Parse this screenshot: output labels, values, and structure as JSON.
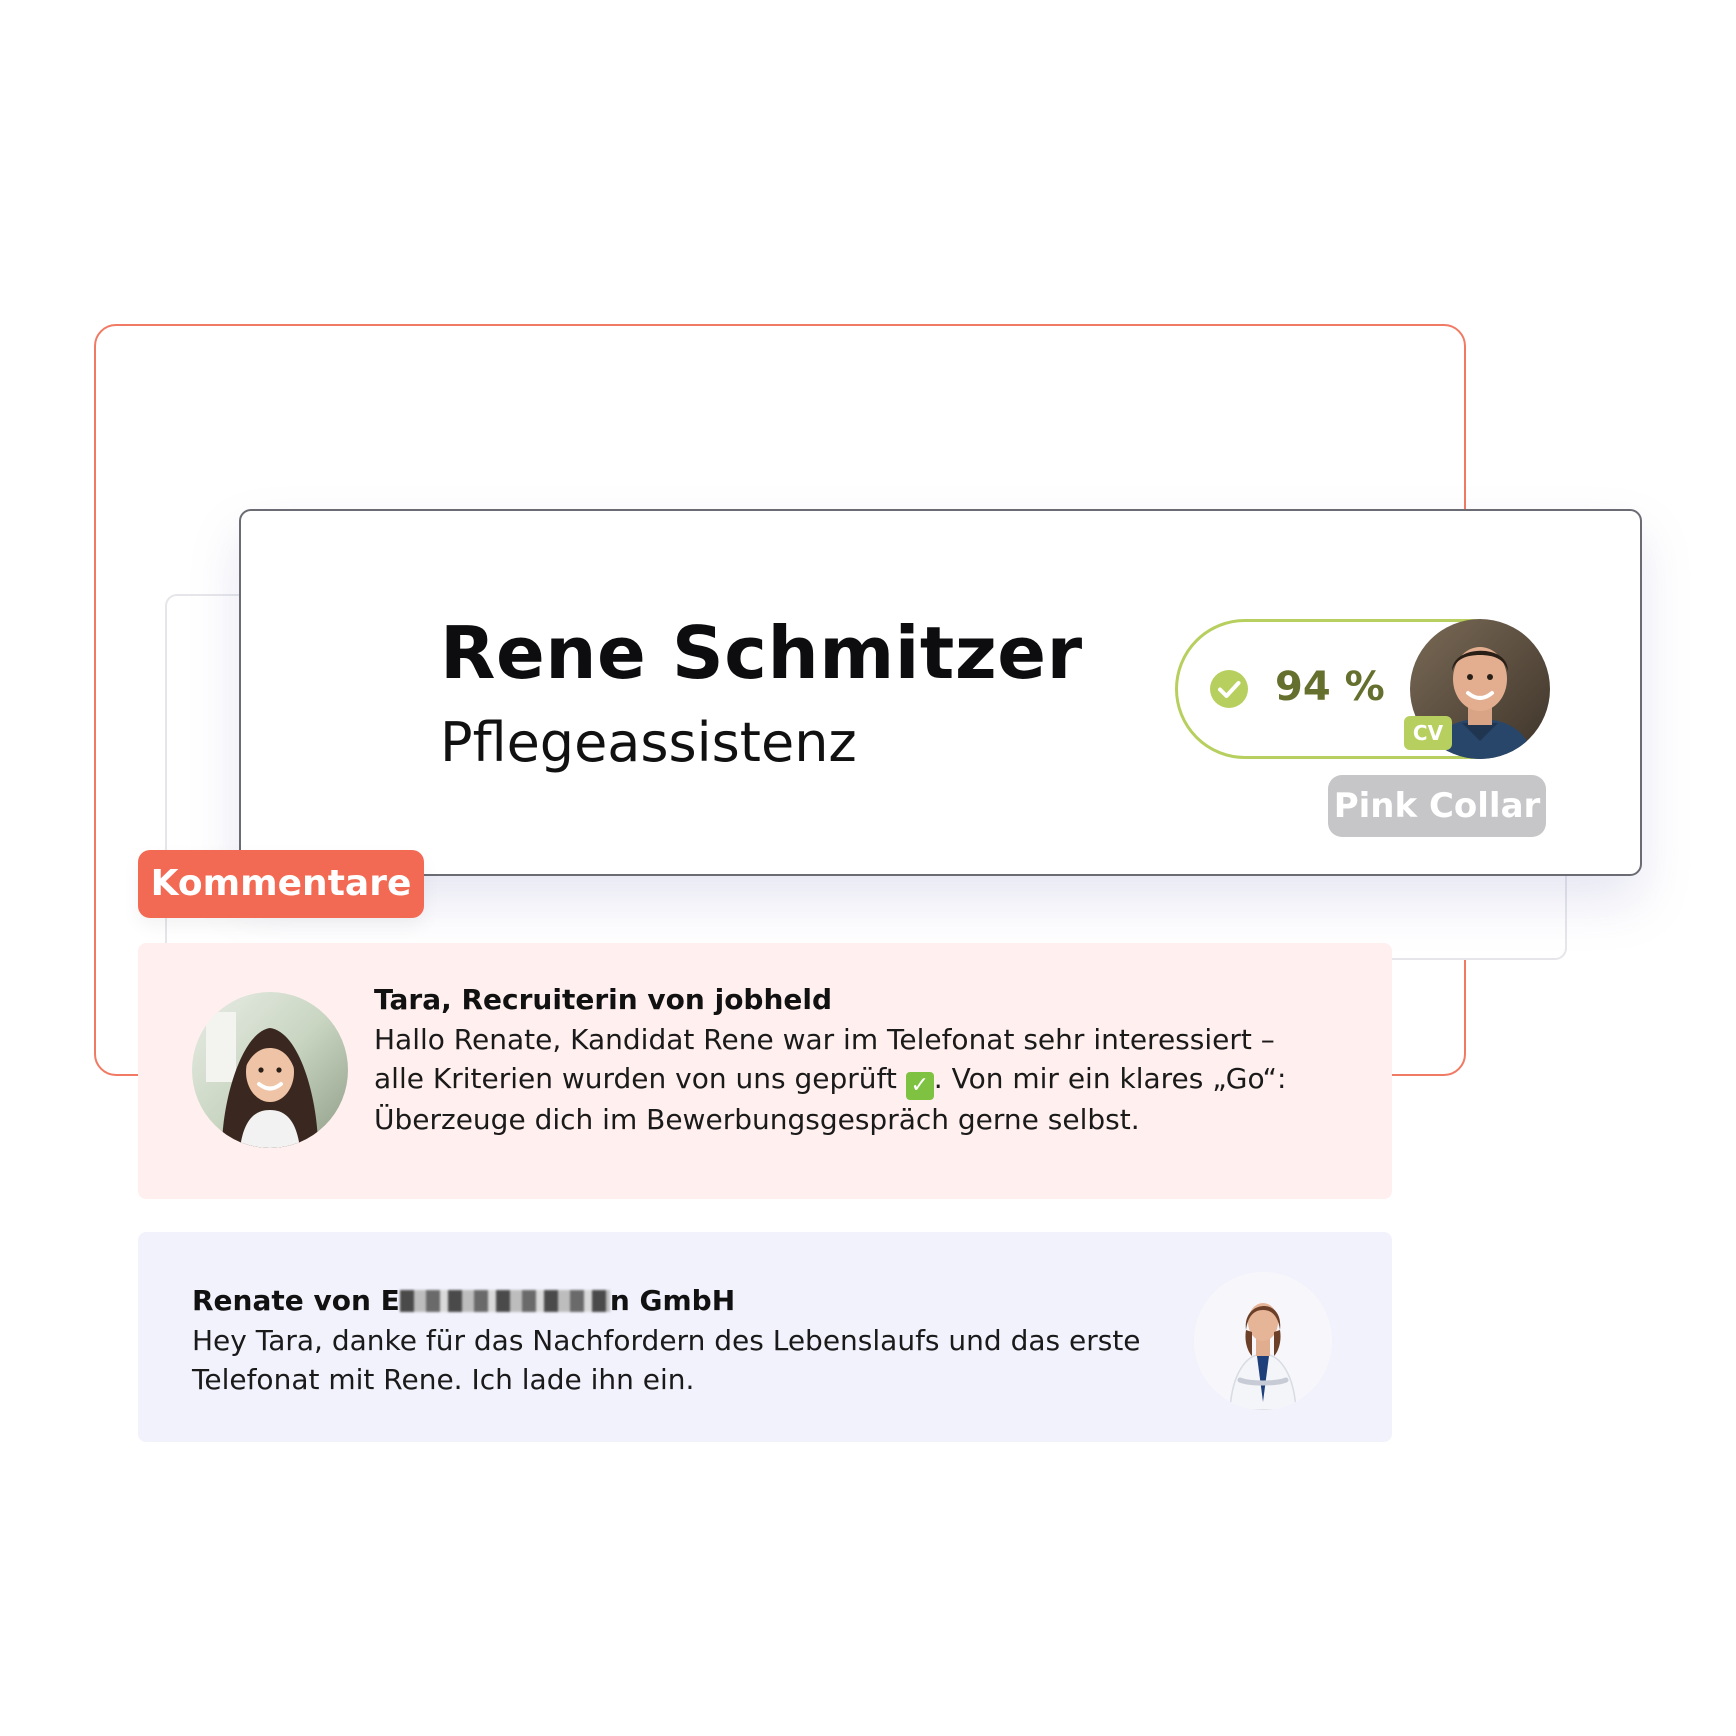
{
  "candidate": {
    "name": "Rene Schmitzer",
    "role": "Pflegeassistenz",
    "match_percent": 94,
    "match_label": "94 %",
    "cv_badge": "CV",
    "tag": "Pink Collar",
    "avatar_icon": "person-photo-male"
  },
  "comments_section": {
    "label": "Kommentare"
  },
  "comments": [
    {
      "author": "Tara,  Recruiterin von jobheld",
      "lines": [
        "Hallo Renate, Kandidat Rene war im Telefonat sehr interessiert –",
        "alle Kriterien wurden von uns geprüft",
        ". Von mir ein klares „Go“:",
        "Überzeuge dich im Bewerbungsgespräch gerne selbst."
      ],
      "inline_icon": "check-mark-emoji",
      "avatar_icon": "person-photo-female"
    },
    {
      "author_prefix": "Renate von E",
      "author_suffix": "n GmbH",
      "lines": [
        "Hey Tara, danke für das Nachfordern des Lebenslaufs und das erste",
        "Telefonat mit Rene. Ich lade ihn ein."
      ],
      "avatar_icon": "person-photo-doctor"
    }
  ],
  "colors": {
    "accent": "#f26a53",
    "match_green": "#b7cf5e",
    "match_text": "#66702e",
    "tag_gray": "#c6c6c8",
    "comment_pink": "#fff0ef",
    "comment_lavender": "#f2f2fd"
  }
}
